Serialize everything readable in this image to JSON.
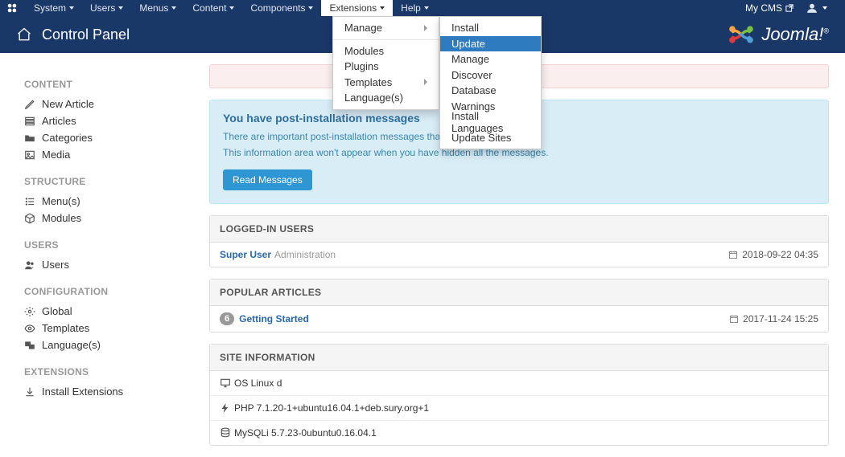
{
  "topnav": {
    "items": [
      "System",
      "Users",
      "Menus",
      "Content",
      "Components",
      "Extensions",
      "Help"
    ],
    "active_index": 5,
    "site_name": "My CMS"
  },
  "dropdown1": {
    "manage": "Manage",
    "items": [
      "Modules",
      "Plugins",
      "Templates",
      "Language(s)"
    ],
    "submenu_index": 2
  },
  "dropdown2": {
    "items": [
      "Install",
      "Update",
      "Manage",
      "Discover",
      "Database",
      "Warnings",
      "Install Languages",
      "Update Sites"
    ],
    "selected_index": 1
  },
  "header": {
    "title": "Control Panel",
    "logo_text": "Joomla!",
    "logo_tm": "®"
  },
  "sidebar": {
    "sections": [
      {
        "heading": "CONTENT",
        "items": [
          {
            "icon": "pencil",
            "label": "New Article"
          },
          {
            "icon": "stack",
            "label": "Articles"
          },
          {
            "icon": "folder",
            "label": "Categories"
          },
          {
            "icon": "image",
            "label": "Media"
          }
        ]
      },
      {
        "heading": "STRUCTURE",
        "items": [
          {
            "icon": "list",
            "label": "Menu(s)"
          },
          {
            "icon": "cube",
            "label": "Modules"
          }
        ]
      },
      {
        "heading": "USERS",
        "items": [
          {
            "icon": "users",
            "label": "Users"
          }
        ]
      },
      {
        "heading": "CONFIGURATION",
        "items": [
          {
            "icon": "gear",
            "label": "Global"
          },
          {
            "icon": "eye",
            "label": "Templates"
          },
          {
            "icon": "lang",
            "label": "Language(s)"
          }
        ]
      },
      {
        "heading": "EXTENSIONS",
        "items": [
          {
            "icon": "download",
            "label": "Install Extensions"
          }
        ]
      }
    ]
  },
  "infobox": {
    "title": "You have post-installation messages",
    "line1": "There are important post-installation messages that require your attention.",
    "line2": "This information area won't appear when you have hidden all the messages.",
    "button": "Read Messages"
  },
  "panels": {
    "logged_in": {
      "heading": "LOGGED-IN USERS",
      "rows": [
        {
          "name": "Super User",
          "role": "Administration",
          "date": "2018-09-22 04:35"
        }
      ]
    },
    "popular": {
      "heading": "POPULAR ARTICLES",
      "rows": [
        {
          "badge": "6",
          "title": "Getting Started",
          "date": "2017-11-24 15:25"
        }
      ]
    },
    "siteinfo": {
      "heading": "SITE INFORMATION",
      "rows": [
        {
          "icon": "screen",
          "text": "OS Linux d"
        },
        {
          "icon": "bolt",
          "text": "PHP 7.1.20-1+ubuntu16.04.1+deb.sury.org+1"
        },
        {
          "icon": "db",
          "text": "MySQLi 5.7.23-0ubuntu0.16.04.1"
        }
      ]
    }
  }
}
